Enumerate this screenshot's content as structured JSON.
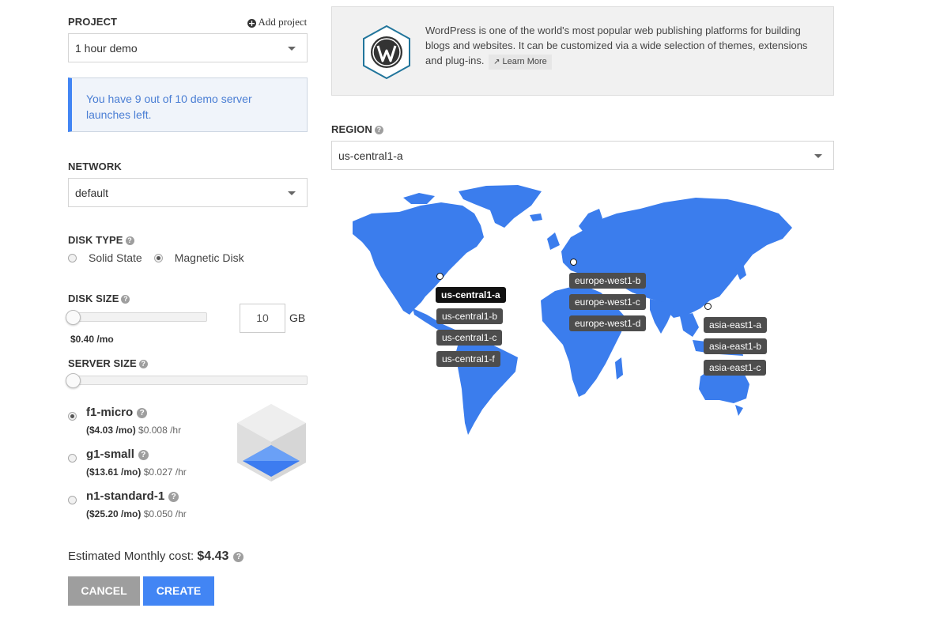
{
  "project": {
    "label": "PROJECT",
    "add_label": "Add project",
    "value": "1 hour demo"
  },
  "notice": "You have 9 out of 10 demo server launches left.",
  "network": {
    "label": "NETWORK",
    "value": "default"
  },
  "disk_type": {
    "label": "DISK TYPE",
    "options": [
      "Solid State",
      "Magnetic Disk"
    ],
    "selected": "Magnetic Disk"
  },
  "disk_size": {
    "label": "DISK SIZE",
    "value": "10",
    "unit": "GB",
    "price": "$0.40 /mo",
    "slider_level": 0
  },
  "server_size": {
    "label": "SERVER SIZE",
    "slider_level": 0,
    "options": [
      {
        "name": "f1-micro",
        "monthly": "($4.03 /mo)",
        "hourly": "$0.008 /hr",
        "selected": true
      },
      {
        "name": "g1-small",
        "monthly": "($13.61 /mo)",
        "hourly": "$0.027 /hr",
        "selected": false
      },
      {
        "name": "n1-standard-1",
        "monthly": "($25.20 /mo)",
        "hourly": "$0.050 /hr",
        "selected": false
      }
    ]
  },
  "cost": {
    "label": "Estimated Monthly cost:",
    "value": "$4.43"
  },
  "buttons": {
    "cancel": "CANCEL",
    "create": "CREATE"
  },
  "app_info": {
    "description": "WordPress is one of the world's most popular web publishing platforms for building blogs and websites. It can be customized via a wide selection of themes, extensions and plug-ins.",
    "learn_more": "Learn More"
  },
  "region": {
    "label": "REGION",
    "value": "us-central1-a",
    "groups": [
      {
        "zones": [
          "us-central1-a",
          "us-central1-b",
          "us-central1-c",
          "us-central1-f"
        ]
      },
      {
        "zones": [
          "europe-west1-b",
          "europe-west1-c",
          "europe-west1-d"
        ]
      },
      {
        "zones": [
          "asia-east1-a",
          "asia-east1-b",
          "asia-east1-c"
        ]
      }
    ]
  },
  "colors": {
    "accent": "#4285f4",
    "map": "#3b7ded",
    "cancel_bg": "#9e9e9e",
    "tag_bg": "#4d4d4d",
    "tag_selected_bg": "#111111"
  }
}
